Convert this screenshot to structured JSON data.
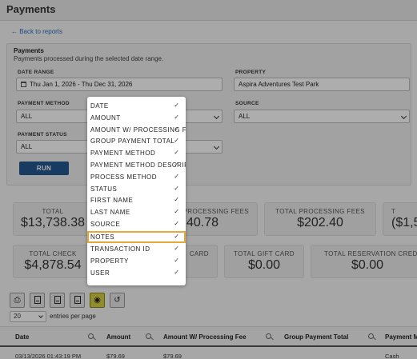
{
  "header": {
    "title": "Payments"
  },
  "back_link": "← Back to reports",
  "filters": {
    "title": "Payments",
    "subtitle": "Payments processed during the selected date range.",
    "date_range": {
      "label": "DATE RANGE",
      "value": "Thu Jan 1, 2026 - Thu Dec 31, 2026"
    },
    "property": {
      "label": "PROPERTY",
      "value": "Aspira Adventures Test Park"
    },
    "payment_method": {
      "label": "PAYMENT METHOD",
      "value": "ALL"
    },
    "source": {
      "label": "SOURCE",
      "value": "ALL"
    },
    "payment_status": {
      "label": "PAYMENT STATUS",
      "value": "ALL"
    },
    "run_label": "RUN"
  },
  "summary_cards": [
    {
      "label": "TOTAL",
      "value": "$13,738.38"
    },
    {
      "label": "PROCESSING FEES",
      "value": "40.78"
    },
    {
      "label": "TOTAL PROCESSING FEES",
      "value": "$202.40"
    },
    {
      "label": "T",
      "value": "($1,5"
    },
    {
      "label": "TOTAL CHECK",
      "value": "$4,878.54"
    },
    {
      "label": "CARD",
      "value": ""
    },
    {
      "label": "TOTAL GIFT CARD",
      "value": "$0.00"
    },
    {
      "label": "TOTAL RESERVATION CRED",
      "value": "$0.00"
    }
  ],
  "entries": {
    "value": "20",
    "label": "entries per page"
  },
  "table": {
    "columns": [
      "Date",
      "Amount",
      "Amount W/ Processing Fee",
      "Group Payment Total",
      "Payment M"
    ],
    "rows": [
      [
        "03/13/2026 01:43:19 PM",
        "$79.69",
        "$79.69",
        "",
        "Cash"
      ]
    ]
  },
  "column_menu": {
    "items": [
      {
        "label": "DATE",
        "checked": "✓"
      },
      {
        "label": "AMOUNT",
        "checked": "✓"
      },
      {
        "label": "AMOUNT W/ PROCESSING F",
        "checked": "✓"
      },
      {
        "label": "GROUP PAYMENT TOTAL",
        "checked": "✓"
      },
      {
        "label": "PAYMENT METHOD",
        "checked": "✓"
      },
      {
        "label": "PAYMENT METHOD DESCRIP",
        "checked": "✓"
      },
      {
        "label": "PROCESS METHOD",
        "checked": "✓"
      },
      {
        "label": "STATUS",
        "checked": "✓"
      },
      {
        "label": "FIRST NAME",
        "checked": "✓"
      },
      {
        "label": "LAST NAME",
        "checked": "✓"
      },
      {
        "label": "SOURCE",
        "checked": "✓"
      },
      {
        "label": "NOTES",
        "checked": "✓"
      },
      {
        "label": "TRANSACTION ID",
        "checked": "✓"
      },
      {
        "label": "PROPERTY",
        "checked": "✓"
      },
      {
        "label": "USER",
        "checked": "✓"
      }
    ],
    "highlighted_item": "NOTES",
    "highlight_color": "#e5a83a"
  },
  "toolbar": {
    "icons": [
      "print-icon",
      "pdf-icon",
      "excel-icon",
      "csv-icon",
      "eye-icon",
      "reset-icon"
    ]
  }
}
